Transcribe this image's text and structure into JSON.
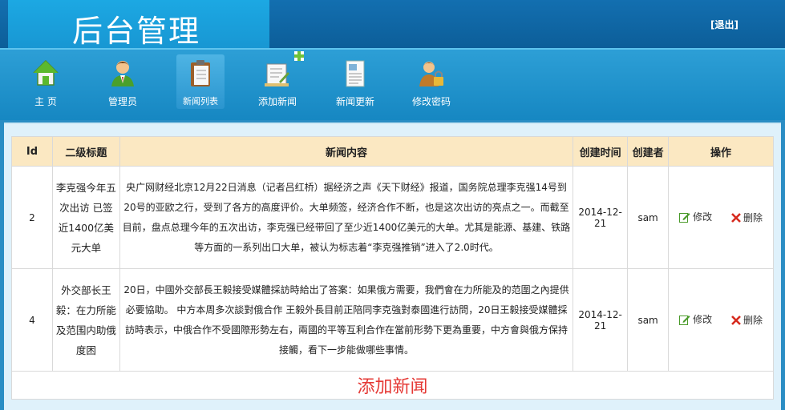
{
  "header": {
    "title": "后台管理",
    "logout_label": "[退出]"
  },
  "nav": {
    "items": [
      {
        "label": "主 页",
        "icon": "home-icon"
      },
      {
        "label": "管理员",
        "icon": "user-icon"
      },
      {
        "label": "新闻列表",
        "icon": "news-list-icon",
        "active": true
      },
      {
        "label": "添加新闻",
        "icon": "add-news-icon"
      },
      {
        "label": "新闻更新",
        "icon": "update-news-icon"
      },
      {
        "label": "修改密码",
        "icon": "change-password-icon"
      }
    ]
  },
  "table": {
    "headers": [
      "Id",
      "二级标题",
      "新闻内容",
      "创建时间",
      "创建者",
      "操作"
    ],
    "rows": [
      {
        "id": "2",
        "title": "李克强今年五次出访 已签近1400亿美元大单",
        "content": "央广网财经北京12月22日消息（记者吕红桥）据经济之声《天下财经》报道，国务院总理李克强14号到20号的亚欧之行，受到了各方的高度评价。大单频签，经济合作不断，也是这次出访的亮点之一。而截至目前，盘点总理今年的五次出访，李克强已经带回了至少近1400亿美元的大单。尤其是能源、基建、铁路等方面的一系列出口大单，被认为标志着“李克强推销”进入了2.0时代。",
        "created": "2014-12-21",
        "creator": "sam",
        "edit_label": "修改",
        "delete_label": "删除"
      },
      {
        "id": "4",
        "title": "外交部长王毅：在力所能及范围内助俄度困",
        "content": "20日，中國外交部長王毅接受媒體採訪時給出了答案：如果俄方需要，我們會在力所能及的范圍之內提供必要協助。 中方本周多次談對俄合作 王毅外長目前正陪同李克強對泰國進行訪問，20日王毅接受媒體採訪時表示，中俄合作不受國際形勢左右，兩國的平等互利合作在當前形勢下更為重要，中方會與俄方保持接觸，看下一步能做哪些事情。",
        "created": "2014-12-21",
        "creator": "sam",
        "edit_label": "修改",
        "delete_label": "删除"
      }
    ],
    "add_label": "添加新闻"
  },
  "colors": {
    "header_bg": "#0c5e99",
    "logo_bg": "#1897d3",
    "nav_bg": "#1687c2",
    "table_header_bg": "#fbe8c2",
    "add_link": "#e53935"
  }
}
